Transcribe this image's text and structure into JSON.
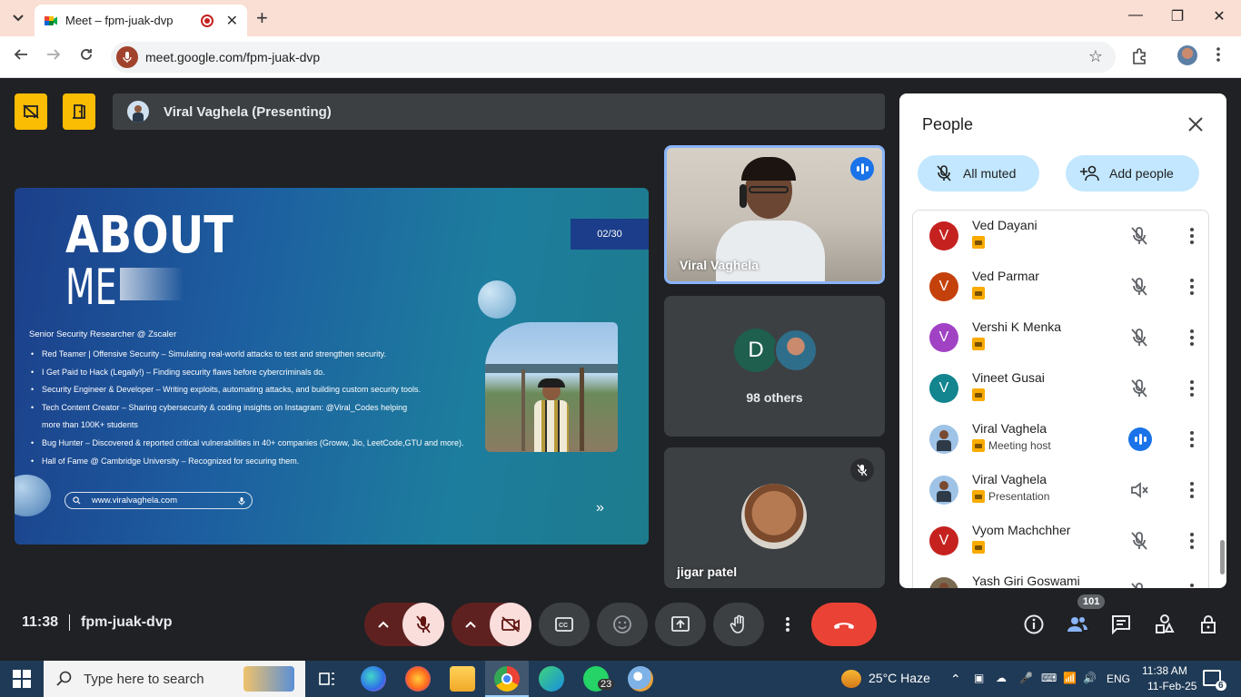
{
  "browser": {
    "tab_title": "Meet – fpm-juak-dvp",
    "url": "meet.google.com/fpm-juak-dvp"
  },
  "meet": {
    "presenting_title": "Viral Vaghela (Presenting)",
    "slide": {
      "heading1": "ABOUT",
      "heading2": "ME",
      "counter": "02/30",
      "subtitle": "Senior Security Researcher @ Zscaler",
      "bullets": [
        "Red Teamer | Offensive Security – Simulating real-world attacks to test and strengthen security.",
        "I Get Paid to Hack (Legally!) – Finding security flaws before cybercriminals do.",
        "Security Engineer & Developer – Writing exploits, automating attacks, and building custom security tools.",
        "Tech Content Creator – Sharing cybersecurity & coding insights on Instagram: @Viral_Codes helping",
        "more than 100K+ students",
        "Bug Hunter – Discovered & reported critical vulnerabilities in 40+ companies (Groww, Jio, LeetCode,GTU  and more).",
        "Hall of Fame @ Cambridge University – Recognized for securing them."
      ],
      "website": "www.viralvaghela.com",
      "arrows": "»"
    },
    "tiles": {
      "presenter_name": "Viral Vaghela",
      "others_avatar_letter": "D",
      "others_text": "98 others",
      "jigar_name": "jigar patel"
    },
    "people": {
      "title": "People",
      "all_muted": "All muted",
      "add_people": "Add people",
      "participants": [
        {
          "name": "Ved Dayani",
          "initial": "V",
          "color": "#c5221f",
          "sub": "",
          "state": "muted"
        },
        {
          "name": "Ved Parmar",
          "initial": "V",
          "color": "#c5410c",
          "sub": "",
          "state": "muted"
        },
        {
          "name": "Vershi K Menka",
          "initial": "V",
          "color": "#a142c4",
          "sub": "",
          "state": "muted"
        },
        {
          "name": "Vineet Gusai",
          "initial": "V",
          "color": "#12858f",
          "sub": "",
          "state": "muted"
        },
        {
          "name": "Viral Vaghela",
          "initial": "",
          "color": "#9ec3e6",
          "sub": "Meeting host",
          "state": "speaking"
        },
        {
          "name": "Viral Vaghela",
          "initial": "",
          "color": "#9ec3e6",
          "sub": "Presentation",
          "state": "audio-off"
        },
        {
          "name": "Vyom Machchher",
          "initial": "V",
          "color": "#c5221f",
          "sub": "",
          "state": "muted"
        },
        {
          "name": "Yash Giri Goswami",
          "initial": "",
          "color": "#7a6a52",
          "sub": "",
          "state": "muted"
        }
      ]
    },
    "bottom": {
      "time": "11:38",
      "meeting_code": "fpm-juak-dvp",
      "people_count": "101"
    }
  },
  "taskbar": {
    "search_placeholder": "Type here to search",
    "whatsapp_badge": "23",
    "weather": "25°C  Haze",
    "lang": "ENG",
    "time": "11:38 AM",
    "date": "11-Feb-25",
    "notifications": "6"
  },
  "colors": {
    "meet_bg": "#202124",
    "accent_yellow": "#fbbc04",
    "end_call_red": "#ea4335",
    "pill_blue": "#c2e7ff",
    "speaking_blue": "#1a73e8"
  }
}
